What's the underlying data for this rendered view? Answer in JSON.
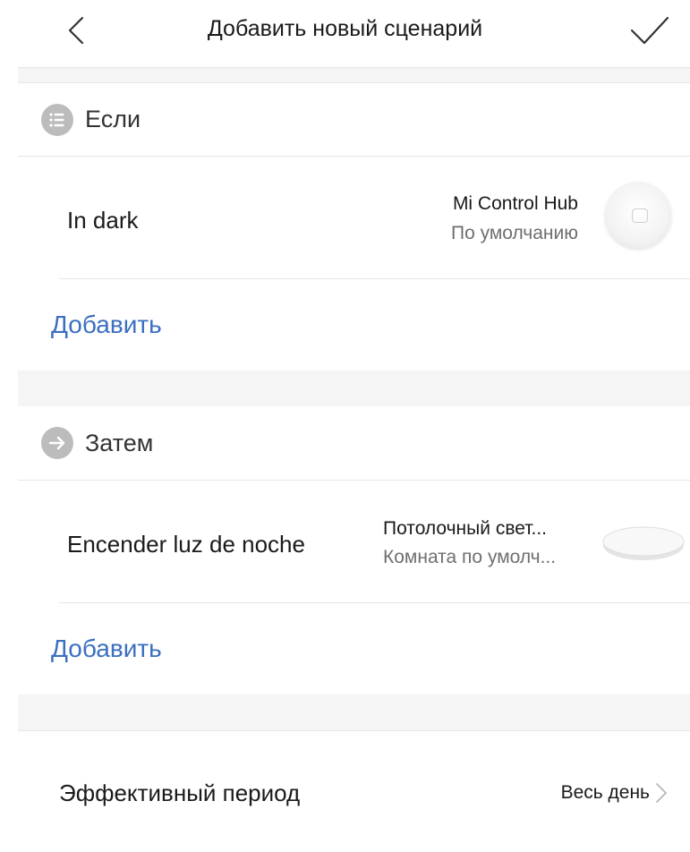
{
  "header": {
    "title": "Добавить новый сценарий",
    "back_icon": "chevron-left-icon",
    "confirm_icon": "checkmark-icon"
  },
  "if_section": {
    "label": "Если",
    "icon": "list-icon",
    "condition": {
      "title": "In dark",
      "device_name": "Mi Control Hub",
      "device_room": "По умолчанию",
      "device_image": "mi-control-hub-icon"
    },
    "add_label": "Добавить"
  },
  "then_section": {
    "label": "Затем",
    "icon": "arrow-right-icon",
    "action": {
      "title": "Encender luz de noche",
      "device_name": "Потолочный свет...",
      "device_room": "Комната по умолч...",
      "device_image": "ceiling-light-icon"
    },
    "add_label": "Добавить"
  },
  "period": {
    "label": "Эффективный период",
    "value": "Весь день"
  },
  "colors": {
    "accent": "#3b6fc1",
    "band": "#f5f5f5",
    "icon_gray": "#bcbcbc"
  }
}
